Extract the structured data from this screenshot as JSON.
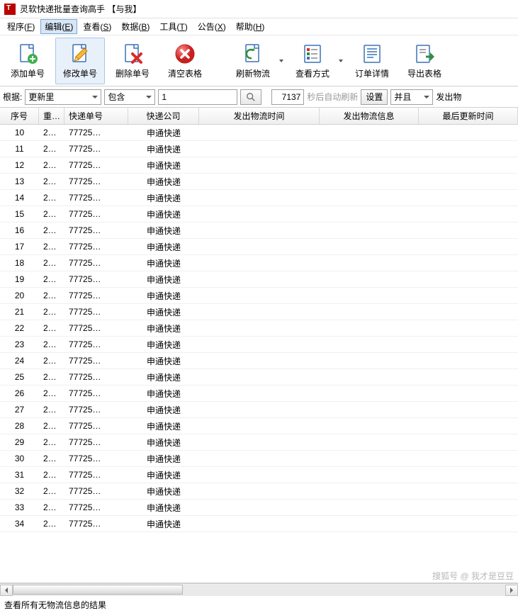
{
  "window": {
    "title": "灵软快递批量查询高手 【与我】"
  },
  "menu": {
    "items": [
      {
        "label": "程序",
        "key": "F"
      },
      {
        "label": "编辑",
        "key": "E",
        "active": true
      },
      {
        "label": "查看",
        "key": "S"
      },
      {
        "label": "数据",
        "key": "B"
      },
      {
        "label": "工具",
        "key": "T"
      },
      {
        "label": "公告",
        "key": "X"
      },
      {
        "label": "帮助",
        "key": "H"
      }
    ]
  },
  "toolbar": {
    "add": "添加单号",
    "edit": "修改单号",
    "delete": "删除单号",
    "clear": "清空表格",
    "refresh": "刷新物流",
    "viewmode": "查看方式",
    "detail": "订单详情",
    "export": "导出表格"
  },
  "filter": {
    "basis_label": "根据:",
    "basis_value": "更新里",
    "op_value": "包含",
    "val_value": "1",
    "count": "7137",
    "auto_label": "秒后自动刷新",
    "settings": "设置",
    "logic": "并且",
    "extra": "发出物"
  },
  "columns": [
    "序号",
    "重…",
    "快递单号",
    "快递公司",
    "发出物流时间",
    "发出物流信息",
    "最后更新时间"
  ],
  "row_template": {
    "col1": "2…",
    "tracking": "77725…",
    "company": "申通快递"
  },
  "row_start": 10,
  "row_end": 34,
  "status": "查看所有无物流信息的结果",
  "watermark": "搜狐号 @ 我才是豆豆"
}
